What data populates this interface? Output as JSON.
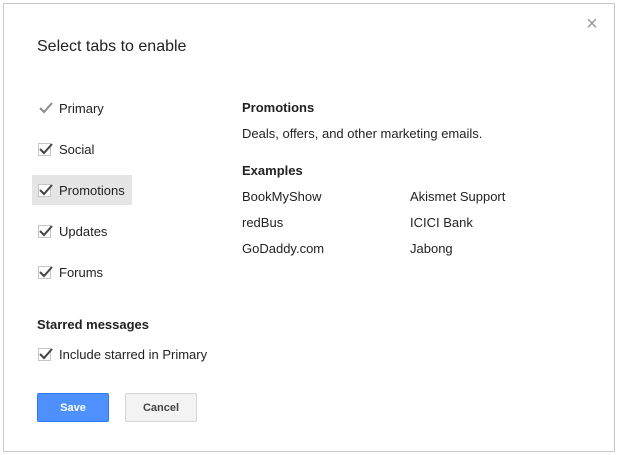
{
  "dialog": {
    "title": "Select tabs to enable",
    "close_glyph": "×"
  },
  "tabs": [
    {
      "label": "Primary",
      "checked": true,
      "locked": true
    },
    {
      "label": "Social",
      "checked": true
    },
    {
      "label": "Promotions",
      "checked": true,
      "selected": true
    },
    {
      "label": "Updates",
      "checked": true
    },
    {
      "label": "Forums",
      "checked": true
    }
  ],
  "starred": {
    "heading": "Starred messages",
    "option_label": "Include starred in Primary",
    "checked": true
  },
  "detail": {
    "heading": "Promotions",
    "description": "Deals, offers, and other marketing emails.",
    "examples_heading": "Examples",
    "examples": [
      "BookMyShow",
      "Akismet Support",
      "redBus",
      "ICICI Bank",
      "GoDaddy.com",
      "Jabong"
    ]
  },
  "buttons": {
    "save": "Save",
    "cancel": "Cancel"
  },
  "colors": {
    "save_bg": "#4d90fe",
    "selected_row_bg": "#e5e5e5"
  },
  "icons": {
    "close": "close-icon",
    "checkmark": "checkmark-icon"
  }
}
